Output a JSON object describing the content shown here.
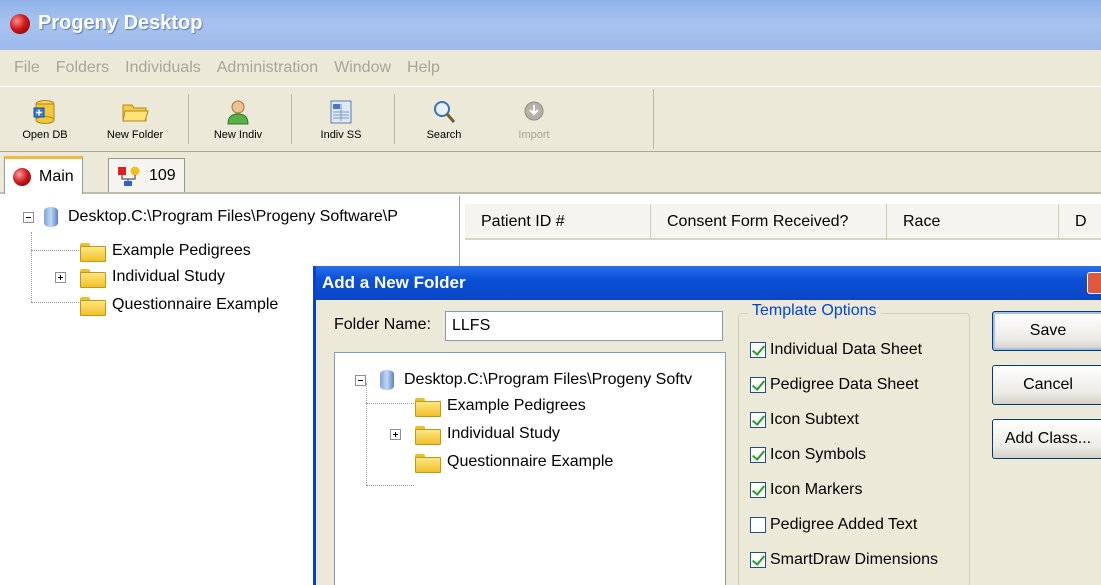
{
  "window": {
    "title": "Progeny Desktop"
  },
  "menu": [
    "File",
    "Folders",
    "Individuals",
    "Administration",
    "Window",
    "Help"
  ],
  "toolbar": {
    "open_db": "Open DB",
    "new_folder": "New Folder",
    "new_indiv": "New Indiv",
    "indiv_ss": "Indiv SS",
    "search": "Search",
    "import": "Import"
  },
  "tabs": [
    {
      "label": "Main"
    },
    {
      "label": "109"
    }
  ],
  "tree": {
    "root": "Desktop.C:\\Program Files\\Progeny Software\\P",
    "items": [
      "Example Pedigrees",
      "Individual Study",
      "Questionnaire Example"
    ]
  },
  "list": {
    "columns": [
      "Patient ID #",
      "Consent Form Received?",
      "Race",
      "D"
    ]
  },
  "dialog": {
    "title": "Add a New Folder",
    "folder_name_label": "Folder Name:",
    "folder_name_value": "LLFS",
    "tree_root": "Desktop.C:\\Program Files\\Progeny Softv",
    "tree_items": [
      "Example Pedigrees",
      "Individual Study",
      "Questionnaire Example"
    ],
    "template_title": "Template Options",
    "options": [
      {
        "label": "Individual Data Sheet",
        "checked": true
      },
      {
        "label": "Pedigree Data Sheet",
        "checked": true
      },
      {
        "label": "Icon Subtext",
        "checked": true
      },
      {
        "label": "Icon Symbols",
        "checked": true
      },
      {
        "label": "Icon Markers",
        "checked": true
      },
      {
        "label": "Pedigree Added Text",
        "checked": false
      },
      {
        "label": "SmartDraw Dimensions",
        "checked": true
      }
    ],
    "buttons": {
      "save": "Save",
      "cancel": "Cancel",
      "add_class": "Add Class..."
    }
  },
  "colors": {
    "titlebar": "#9cb9ec",
    "dialog_title": "#0a50d8",
    "accent": "#f5b840",
    "legend": "#0046d5"
  }
}
